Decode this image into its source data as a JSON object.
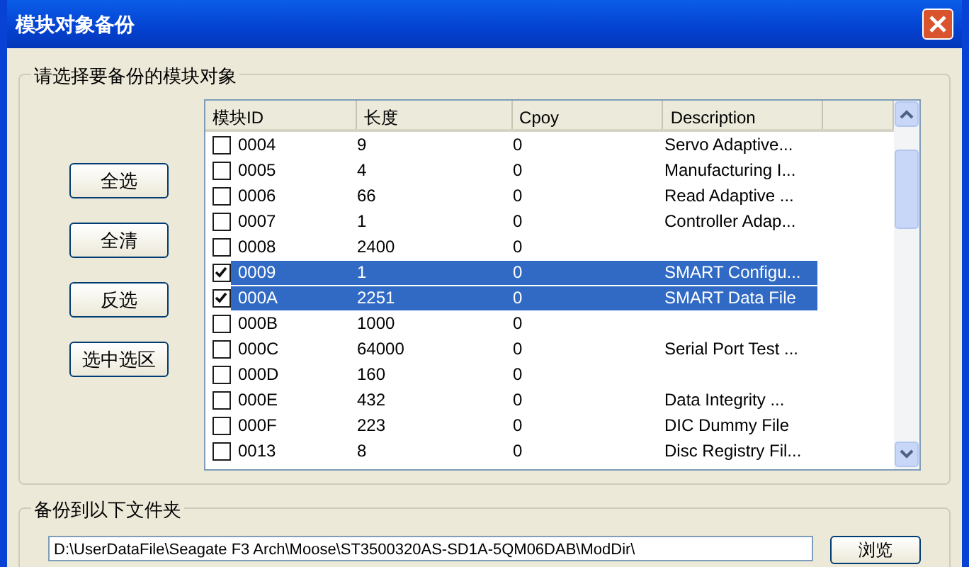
{
  "window": {
    "title": "模块对象备份"
  },
  "module_group": {
    "label": "请选择要备份的模块对象",
    "buttons": [
      "全选",
      "全清",
      "反选",
      "选中选区"
    ],
    "table": {
      "columns": [
        "模块ID",
        "长度",
        "Cpoy",
        "Description"
      ],
      "rows": [
        {
          "id": "0004",
          "length": "9",
          "copy": "0",
          "description": "Servo Adaptive...",
          "checked": false,
          "selected": false
        },
        {
          "id": "0005",
          "length": "4",
          "copy": "0",
          "description": "Manufacturing I...",
          "checked": false,
          "selected": false
        },
        {
          "id": "0006",
          "length": "66",
          "copy": "0",
          "description": "Read Adaptive ...",
          "checked": false,
          "selected": false
        },
        {
          "id": "0007",
          "length": "1",
          "copy": "0",
          "description": "Controller Adap...",
          "checked": false,
          "selected": false
        },
        {
          "id": "0008",
          "length": "2400",
          "copy": "0",
          "checked": false,
          "selected": false
        },
        {
          "id": "0009",
          "length": "1",
          "copy": "0",
          "description": "SMART Configu...",
          "checked": true,
          "selected": true
        },
        {
          "id": "000A",
          "length": "2251",
          "copy": "0",
          "description": "SMART Data File",
          "checked": true,
          "selected": true
        },
        {
          "id": "000B",
          "length": "1000",
          "copy": "0",
          "checked": false,
          "selected": false
        },
        {
          "id": "000C",
          "length": "64000",
          "copy": "0",
          "description": "Serial Port Test ...",
          "checked": false,
          "selected": false
        },
        {
          "id": "000D",
          "length": "160",
          "copy": "0",
          "checked": false,
          "selected": false
        },
        {
          "id": "000E",
          "length": "432",
          "copy": "0",
          "description": "Data Integrity ...",
          "checked": false,
          "selected": false
        },
        {
          "id": "000F",
          "length": "223",
          "copy": "0",
          "description": "DIC Dummy File",
          "checked": false,
          "selected": false
        },
        {
          "id": "0013",
          "length": "8",
          "copy": "0",
          "description": "Disc Registry Fil...",
          "checked": false,
          "selected": false
        }
      ]
    }
  },
  "folder_group": {
    "label": "备份到以下文件夹",
    "path": "D:\\UserDataFile\\Seagate F3 Arch\\Moose\\ST3500320AS-SD1A-5QM06DAB\\ModDir\\",
    "browse_button": "浏览"
  }
}
